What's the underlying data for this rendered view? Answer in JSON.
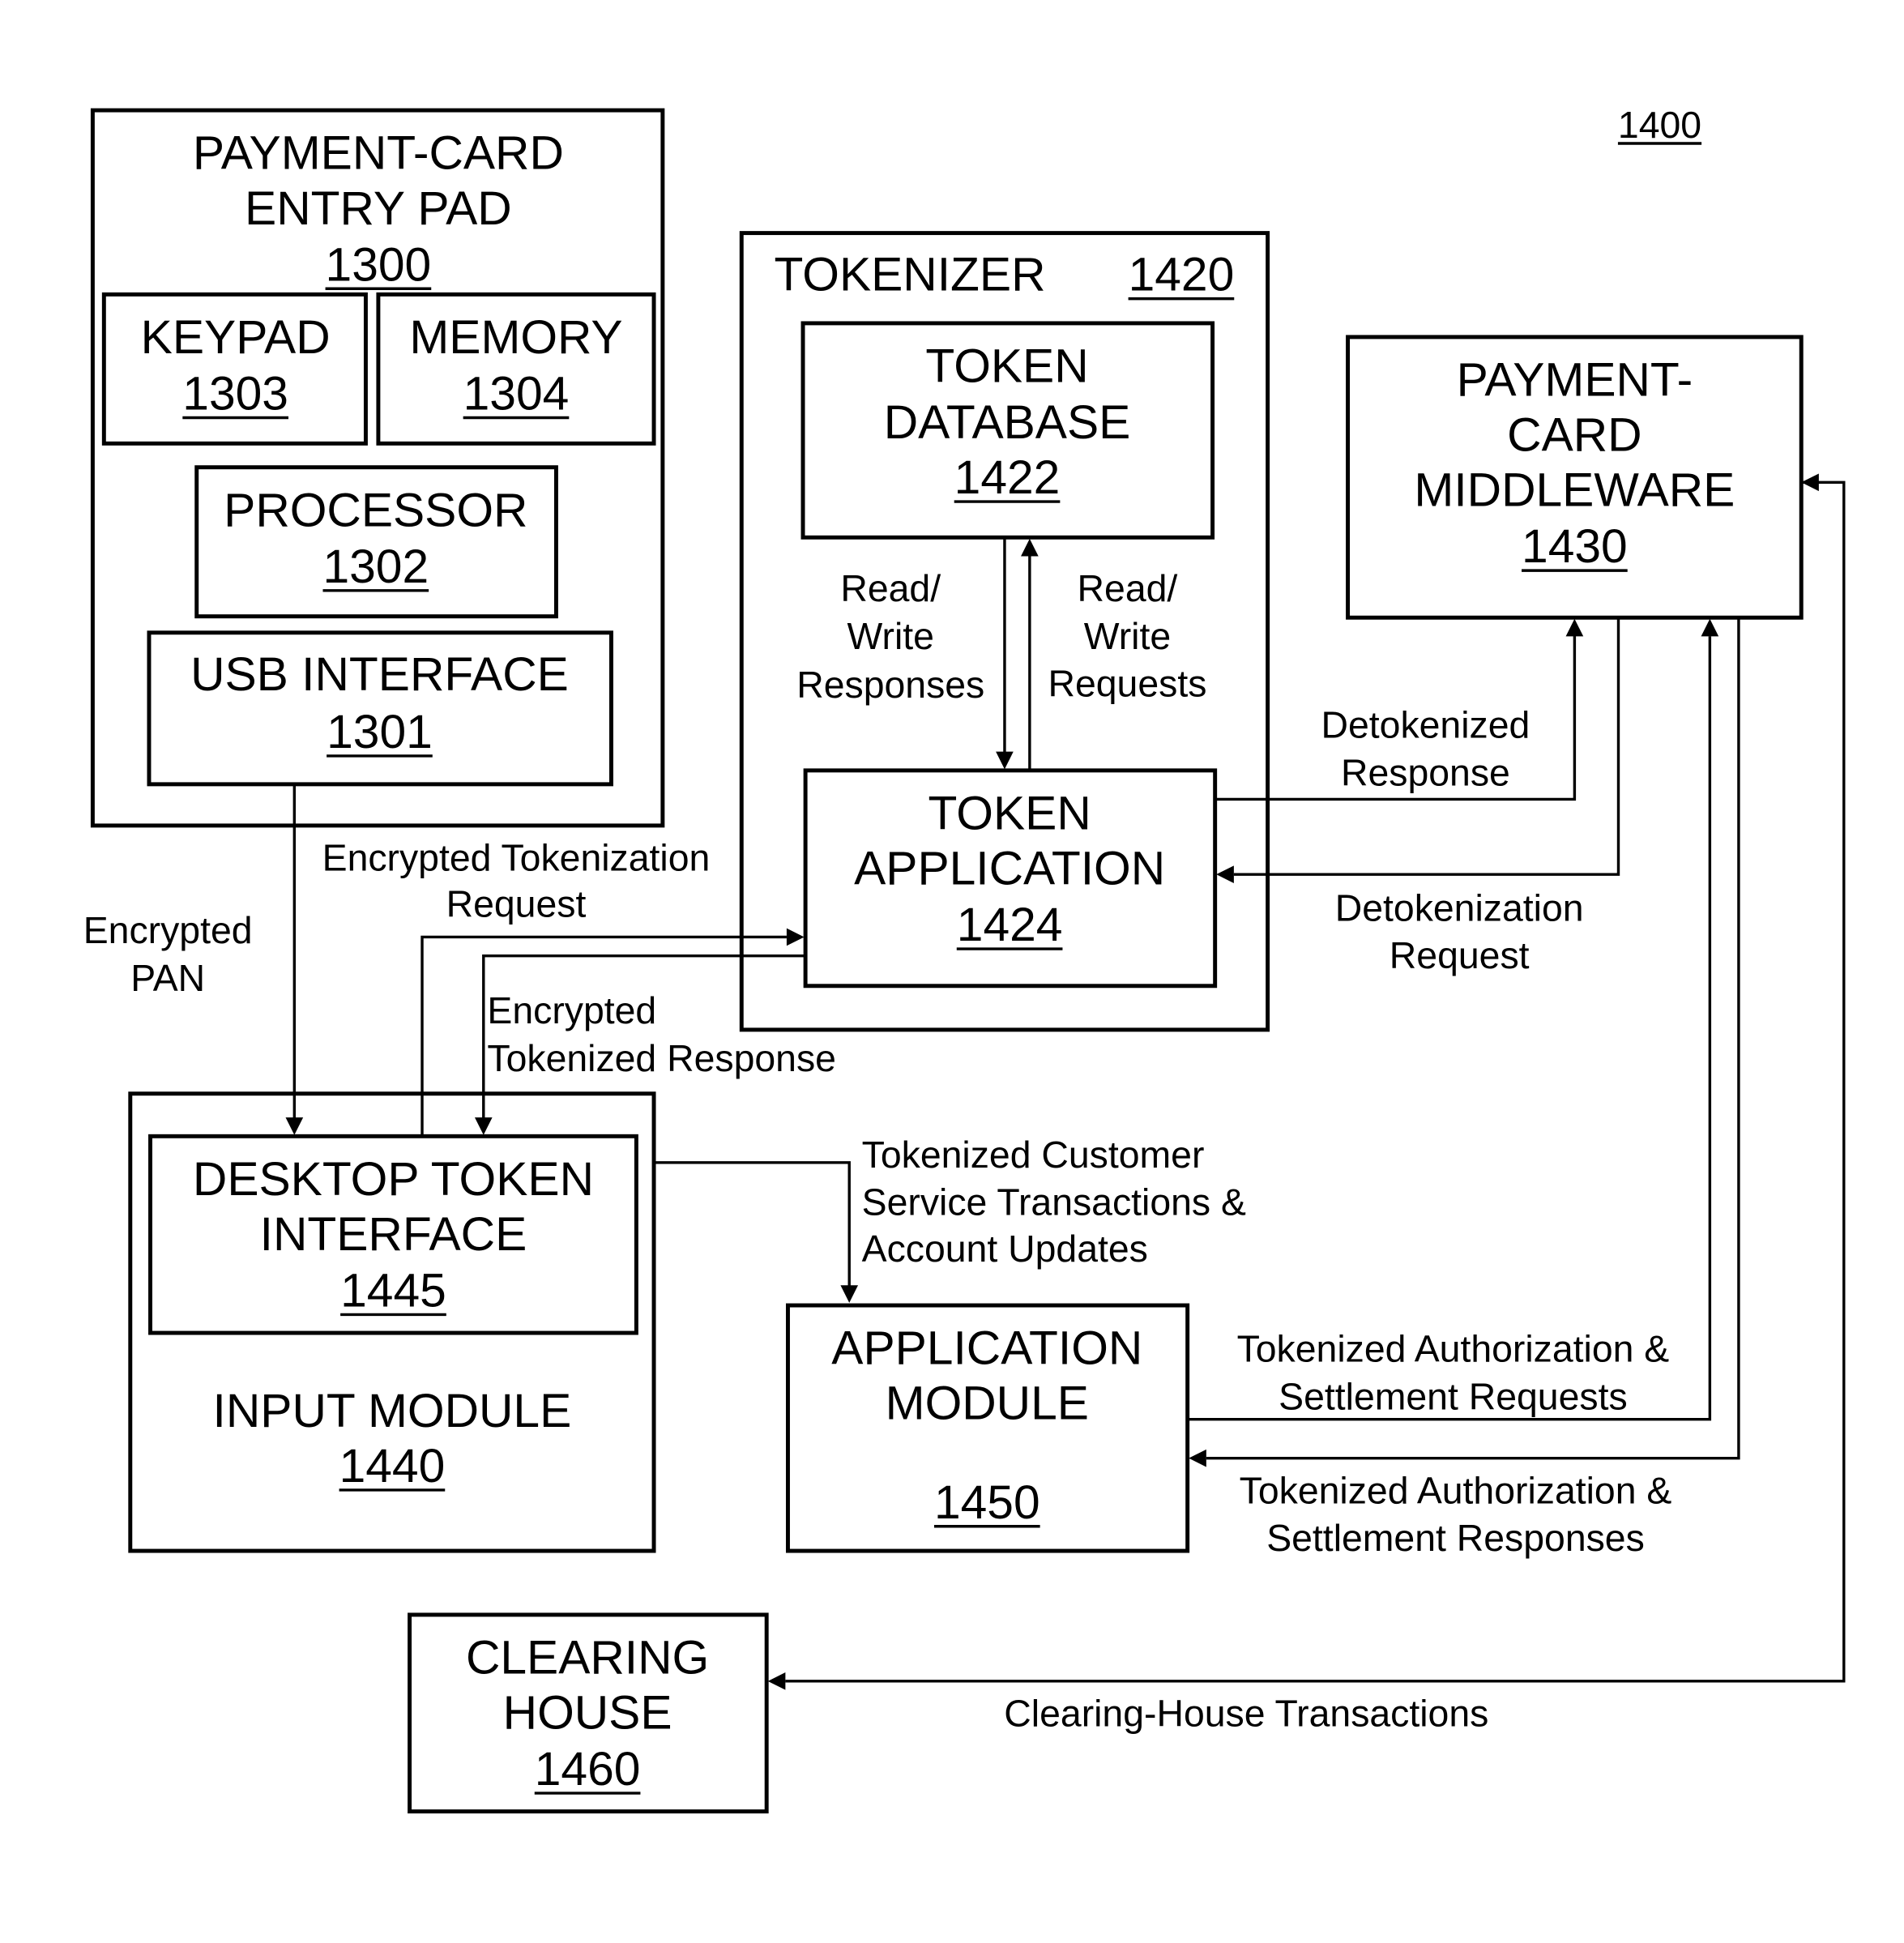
{
  "figure_ref": "1400",
  "blocks": {
    "entry_pad": {
      "title": [
        "PAYMENT-CARD",
        "ENTRY PAD"
      ],
      "ref": "1300"
    },
    "keypad": {
      "title": [
        "KEYPAD"
      ],
      "ref": "1303"
    },
    "memory": {
      "title": [
        "MEMORY"
      ],
      "ref": "1304"
    },
    "processor": {
      "title": [
        "PROCESSOR"
      ],
      "ref": "1302"
    },
    "usb": {
      "title": [
        "USB INTERFACE"
      ],
      "ref": "1301"
    },
    "tokenizer": {
      "title": [
        "TOKENIZER"
      ],
      "ref": "1420"
    },
    "token_db": {
      "title": [
        "TOKEN",
        "DATABASE"
      ],
      "ref": "1422"
    },
    "token_app": {
      "title": [
        "TOKEN",
        "APPLICATION"
      ],
      "ref": "1424"
    },
    "middleware": {
      "title": [
        "PAYMENT-",
        "CARD",
        "MIDDLEWARE"
      ],
      "ref": "1430"
    },
    "input_module": {
      "title": [
        "INPUT MODULE"
      ],
      "ref": "1440"
    },
    "desktop_token": {
      "title": [
        "DESKTOP TOKEN",
        "INTERFACE"
      ],
      "ref": "1445"
    },
    "app_module": {
      "title": [
        "APPLICATION",
        "MODULE"
      ],
      "ref": "1450"
    },
    "clearing_house": {
      "title": [
        "CLEARING",
        "HOUSE"
      ],
      "ref": "1460"
    }
  },
  "flows": {
    "rw_responses": [
      "Read/",
      "Write",
      "Responses"
    ],
    "rw_requests": [
      "Read/",
      "Write",
      "Requests"
    ],
    "detok_response": [
      "Detokenized",
      "Response"
    ],
    "detok_request": [
      "Detokenization",
      "Request"
    ],
    "enc_pan": [
      "Encrypted",
      "PAN"
    ],
    "enc_tok_request": [
      "Encrypted Tokenization",
      "Request"
    ],
    "enc_tok_response": [
      "Encrypted",
      "Tokenized Response"
    ],
    "cs_transactions": [
      "Tokenized Customer",
      "Service Transactions &",
      "Account Updates"
    ],
    "auth_requests": [
      "Tokenized Authorization &",
      "Settlement Requests"
    ],
    "auth_responses": [
      "Tokenized Authorization &",
      "Settlement Responses"
    ],
    "clearing_tx": [
      "Clearing-House Transactions"
    ]
  }
}
